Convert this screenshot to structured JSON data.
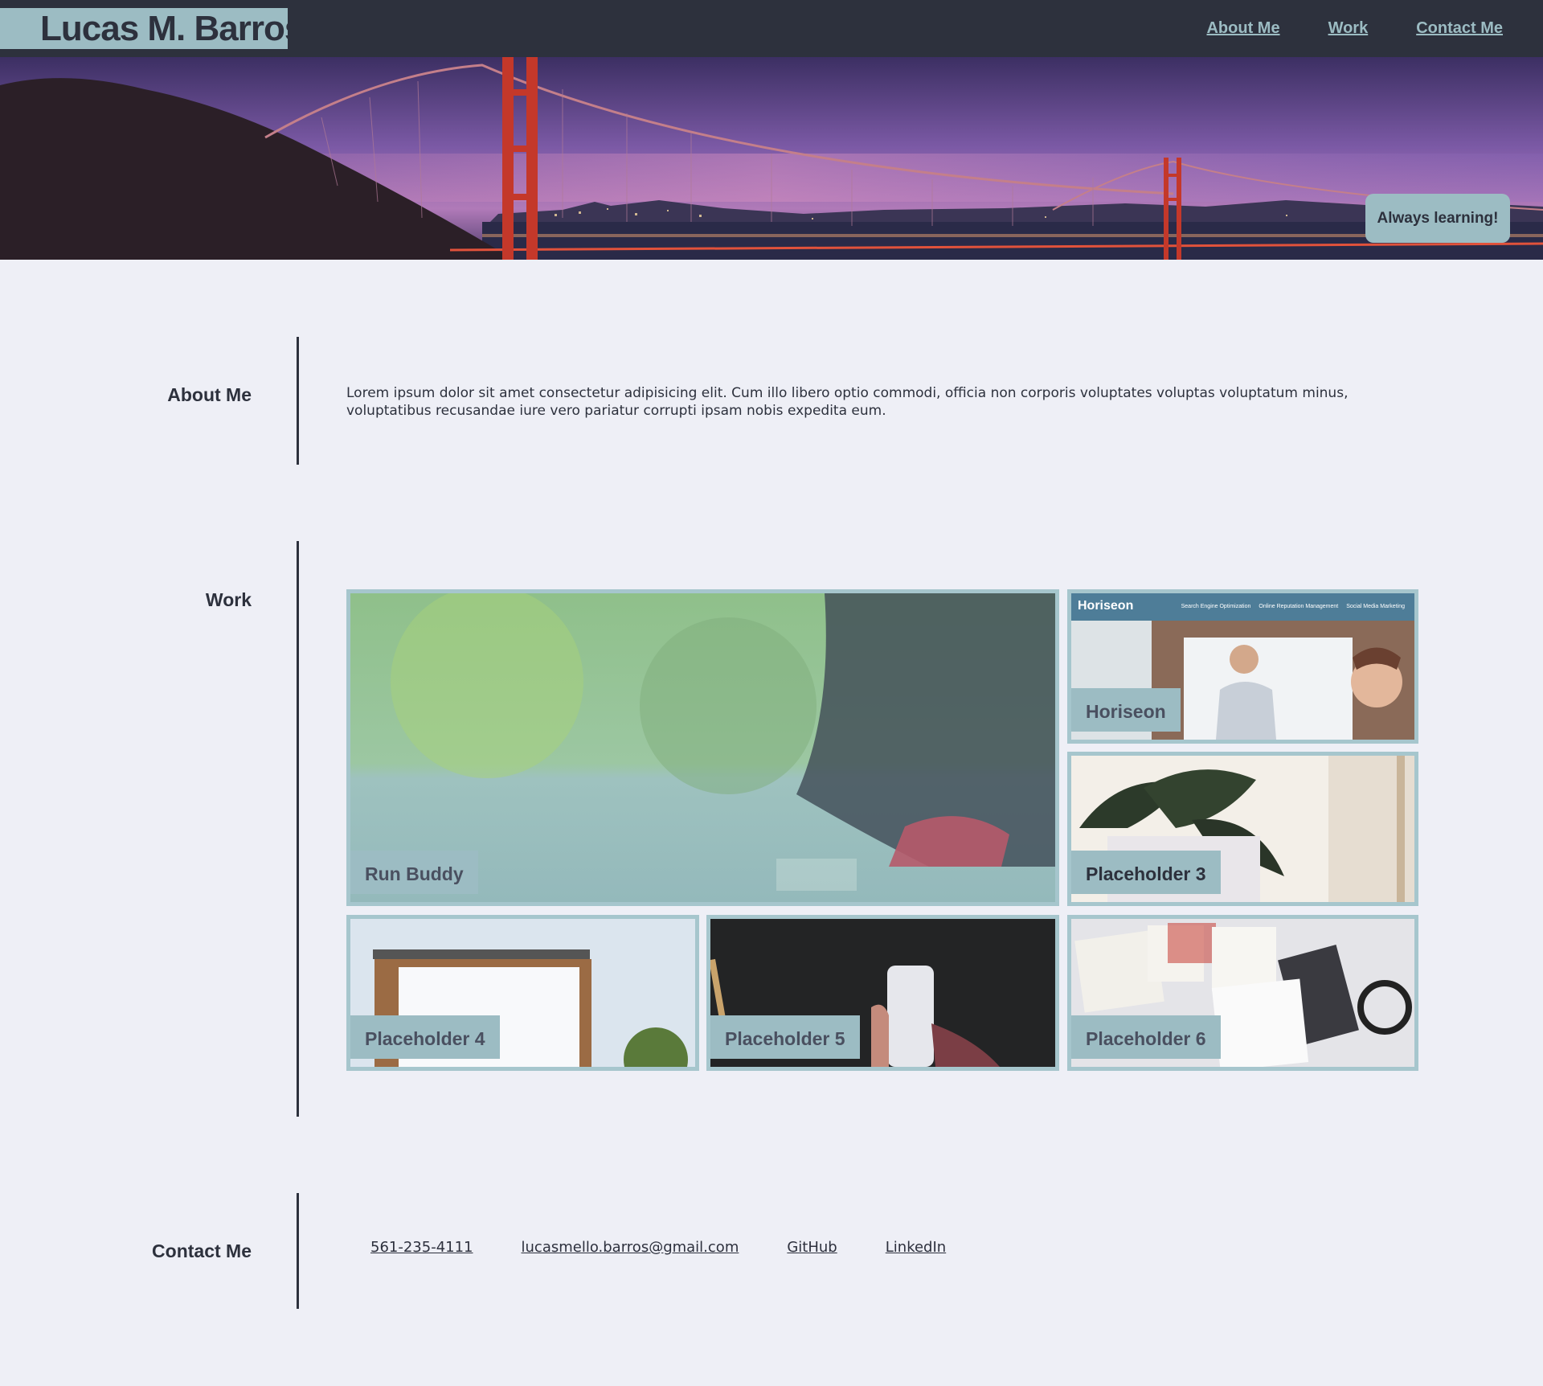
{
  "header": {
    "brand": "Lucas M. Barros",
    "nav": [
      {
        "label": "About Me"
      },
      {
        "label": "Work"
      },
      {
        "label": "Contact Me"
      }
    ]
  },
  "hero": {
    "badge": "Always learning!"
  },
  "about": {
    "title": "About Me",
    "text": "Lorem ipsum dolor sit amet consectetur adipisicing elit. Cum illo libero optio commodi, officia non corporis voluptates voluptas voluptatum minus, voluptatibus recusandae iure vero pariatur corrupti ipsam nobis expedita eum."
  },
  "work": {
    "title": "Work",
    "projects": [
      {
        "label": "Run Buddy"
      },
      {
        "label": "Horiseon",
        "screenshot_brand": "Horiseon",
        "screenshot_nav": [
          "Search Engine Optimization",
          "Online Reputation Management",
          "Social Media Marketing"
        ]
      },
      {
        "label": "Placeholder 3"
      },
      {
        "label": "Placeholder 4"
      },
      {
        "label": "Placeholder 5"
      },
      {
        "label": "Placeholder 6"
      }
    ]
  },
  "contact": {
    "title": "Contact Me",
    "links": [
      {
        "label": "561-235-4111"
      },
      {
        "label": "lucasmello.barros@gmail.com"
      },
      {
        "label": "GitHub"
      },
      {
        "label": "LinkedIn"
      }
    ]
  },
  "colors": {
    "header_bg": "#2d313d",
    "accent": "#9cbcc3",
    "page_bg": "#eeeff6",
    "text": "#2d303d"
  }
}
